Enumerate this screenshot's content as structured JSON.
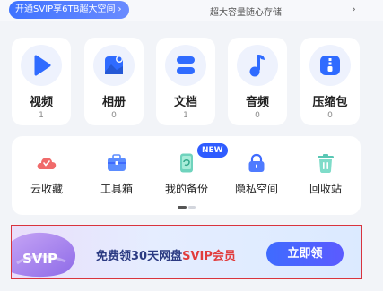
{
  "banner": {
    "promo_label": "开通SVIP享6TB超大空间",
    "promo_chevron": "›",
    "tagline": "超大容量随心存储",
    "tagline_chevron": "›"
  },
  "categories": [
    {
      "label": "视频",
      "count": "1",
      "icon": "play-icon"
    },
    {
      "label": "相册",
      "count": "0",
      "icon": "photo-icon"
    },
    {
      "label": "文档",
      "count": "1",
      "icon": "document-icon"
    },
    {
      "label": "音频",
      "count": "0",
      "icon": "music-note-icon"
    },
    {
      "label": "压缩包",
      "count": "0",
      "icon": "zip-icon"
    }
  ],
  "tools": {
    "items": [
      {
        "label": "云收藏",
        "icon": "cloud-bookmark-icon"
      },
      {
        "label": "工具箱",
        "icon": "toolbox-icon"
      },
      {
        "label": "我的备份",
        "icon": "phone-backup-icon"
      },
      {
        "label": "隐私空间",
        "icon": "lock-icon"
      },
      {
        "label": "回收站",
        "icon": "trash-icon"
      }
    ],
    "new_badge": "NEW"
  },
  "ad": {
    "logo_text": "SVIP",
    "title_prefix": "免费领30天网盘",
    "title_highlight": "SVIP会员",
    "button": "立即领"
  },
  "colors": {
    "accent": "#2f6bff",
    "badge": "#2f5cff",
    "highlight": "#e13c3c",
    "border": "#d9343d"
  }
}
